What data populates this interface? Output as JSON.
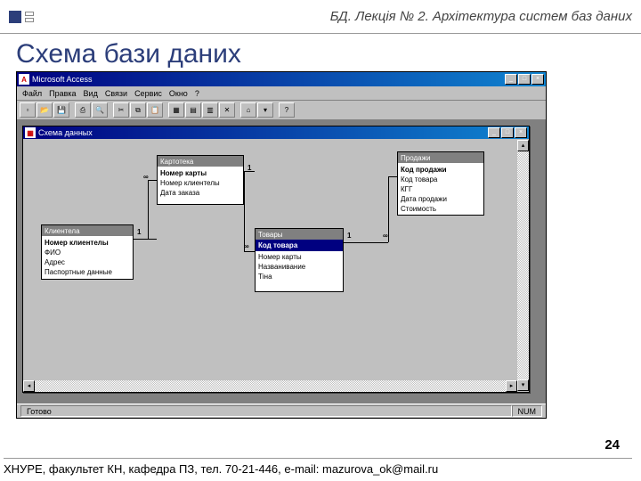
{
  "header": {
    "text": "БД. Лекція № 2. Архітектура систем баз даних"
  },
  "slide_title": "Схема бази даних",
  "app": {
    "title_icon": "A",
    "title": "Microsoft Access",
    "menu": [
      "Файл",
      "Правка",
      "Вид",
      "Связи",
      "Сервис",
      "Окно",
      "?"
    ],
    "status_left": "Готово",
    "status_right": "NUM"
  },
  "child": {
    "title": "Схема данных"
  },
  "tables": {
    "kartotska": {
      "name": "Картотека",
      "fields": [
        "Номер карты",
        "Номер клиентелы",
        "Дата заказа"
      ]
    },
    "klientela": {
      "name": "Клиентела",
      "fields": [
        "Номер клиентелы",
        "ФИО",
        "Адрес",
        "Паспортные данные"
      ]
    },
    "tovary": {
      "name": "Товары",
      "fields": [
        "Код товара",
        "Номер карты",
        "Названивание",
        "Тіна"
      ]
    },
    "prodazhi": {
      "name": "Продажи",
      "fields": [
        "Код продажи",
        "Код товара",
        "КГГ",
        "Дата продажи",
        "Стоимость"
      ]
    }
  },
  "rel": {
    "one": "1",
    "many": "∞"
  },
  "footer": {
    "text": "ХНУРЕ, факультет КН, кафедра ПЗ, тел. 70-21-446, e-mail: mazurova_ok@mail.ru",
    "page": "24"
  }
}
